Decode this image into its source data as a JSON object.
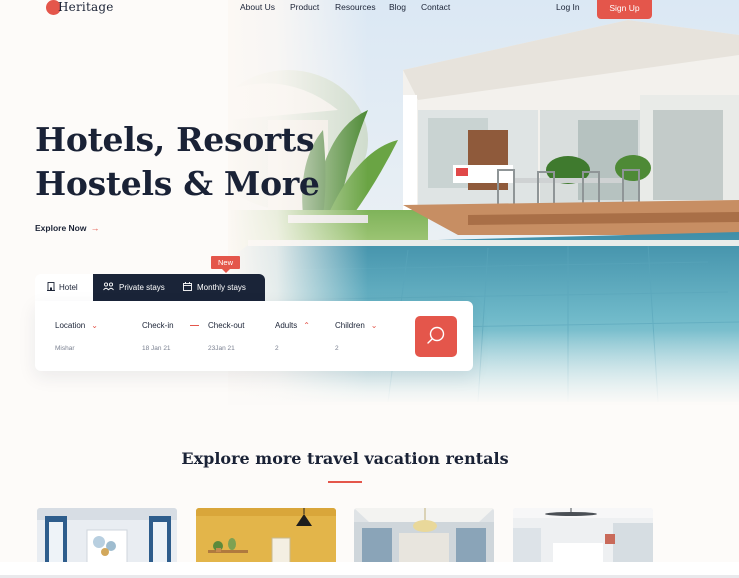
{
  "brand": {
    "logo_text": "Heritage",
    "accent_color": "#e4564b",
    "dark_color": "#1a2438"
  },
  "nav": {
    "items": [
      {
        "label": "About Us"
      },
      {
        "label": "Product"
      },
      {
        "label": "Resources"
      },
      {
        "label": "Blog"
      },
      {
        "label": "Contact"
      }
    ],
    "login_label": "Log In",
    "signup_label": "Sign Up"
  },
  "hero": {
    "title_line1": "Hotels, Resorts",
    "title_line2": "Hostels & More",
    "cta_label": "Explore Now",
    "cta_icon": "arrow-right-icon"
  },
  "search": {
    "tabs": [
      {
        "label": "Hotel",
        "icon": "hotel-icon",
        "active": true
      },
      {
        "label": "Private stays",
        "icon": "private-stays-icon",
        "active": false
      },
      {
        "label": "Monthly stays",
        "icon": "calendar-icon",
        "active": false
      }
    ],
    "new_badge": "New",
    "fields": {
      "location": {
        "label": "Location",
        "value": "Mishar"
      },
      "checkin": {
        "label": "Check-in",
        "value": "18 Jan 21"
      },
      "checkout": {
        "label": "Check-out",
        "value": "23Jan 21"
      },
      "adults": {
        "label": "Adults",
        "value": "2"
      },
      "children": {
        "label": "Children",
        "value": "2"
      }
    },
    "search_icon": "search-icon"
  },
  "explore": {
    "title": "Explore more travel vacation rentals",
    "rentals": [
      {
        "image": "rental-room-1"
      },
      {
        "image": "rental-room-2"
      },
      {
        "image": "rental-room-3"
      },
      {
        "image": "rental-room-4"
      }
    ]
  }
}
